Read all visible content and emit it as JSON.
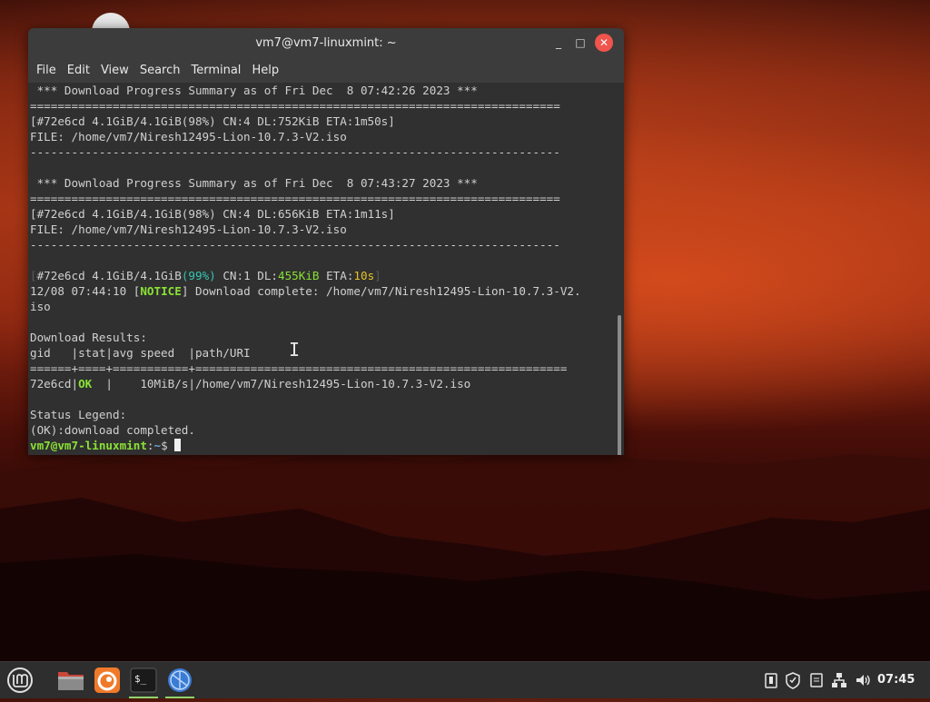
{
  "window": {
    "title": "vm7@vm7-linuxmint: ~",
    "minimize_glyph": "_",
    "maximize_glyph": "□",
    "close_glyph": "✕"
  },
  "menu": [
    "File",
    "Edit",
    "View",
    "Search",
    "Terminal",
    "Help"
  ],
  "terminal": {
    "lines": [
      [
        {
          "t": " *** Download Progress Summary as of Fri Dec  8 07:42:26 2023 ***"
        }
      ],
      [
        {
          "t": "============================================================================="
        }
      ],
      [
        {
          "t": "[#72e6cd 4.1GiB/4.1GiB(98%) CN:4 DL:752KiB ETA:1m50s]"
        }
      ],
      [
        {
          "t": "FILE: /home/vm7/Niresh12495-Lion-10.7.3-V2.iso"
        }
      ],
      [
        {
          "t": "-----------------------------------------------------------------------------"
        }
      ],
      [
        {
          "t": ""
        }
      ],
      [
        {
          "t": " *** Download Progress Summary as of Fri Dec  8 07:43:27 2023 ***"
        }
      ],
      [
        {
          "t": "============================================================================="
        }
      ],
      [
        {
          "t": "[#72e6cd 4.1GiB/4.1GiB(98%) CN:4 DL:656KiB ETA:1m11s]"
        }
      ],
      [
        {
          "t": "FILE: /home/vm7/Niresh12495-Lion-10.7.3-V2.iso"
        }
      ],
      [
        {
          "t": "-----------------------------------------------------------------------------"
        }
      ],
      [
        {
          "t": ""
        }
      ],
      [
        {
          "t": "[",
          "c": "dim"
        },
        {
          "t": "#72e6cd 4.1GiB/4.1GiB"
        },
        {
          "t": "(99%)",
          "c": "cyan"
        },
        {
          "t": " CN:1 DL:"
        },
        {
          "t": "455KiB",
          "c": "green"
        },
        {
          "t": " ETA:"
        },
        {
          "t": "10s",
          "c": "yellow"
        },
        {
          "t": "]",
          "c": "dim"
        }
      ],
      [
        {
          "t": "12/08 07:44:10 ["
        },
        {
          "t": "NOTICE",
          "c": "boldgreen"
        },
        {
          "t": "] Download complete: /home/vm7/Niresh12495-Lion-10.7.3-V2."
        }
      ],
      [
        {
          "t": "iso"
        }
      ],
      [
        {
          "t": ""
        }
      ],
      [
        {
          "t": "Download Results:"
        }
      ],
      [
        {
          "t": "gid   |stat|avg speed  |path/URI"
        }
      ],
      [
        {
          "t": "======+====+===========+======================================================"
        }
      ],
      [
        {
          "t": "72e6cd|"
        },
        {
          "t": "OK",
          "c": "boldgreen"
        },
        {
          "t": "  |    10MiB/s|/home/vm7/Niresh12495-Lion-10.7.3-V2.iso"
        }
      ],
      [
        {
          "t": ""
        }
      ],
      [
        {
          "t": "Status Legend:"
        }
      ],
      [
        {
          "t": "(OK):download completed."
        }
      ]
    ],
    "prompt_user": "vm7@vm7-linuxmint",
    "prompt_sep": ":",
    "prompt_path": "~",
    "prompt_symbol": "$ "
  },
  "taskbar": {
    "items": [
      {
        "name": "menu-button",
        "icon": "mint-logo-icon"
      },
      {
        "name": "taskbar-files",
        "icon": "folder-icon"
      },
      {
        "name": "taskbar-firefox",
        "icon": "firefox-icon"
      },
      {
        "name": "taskbar-terminal",
        "icon": "terminal-icon",
        "label": "$_"
      },
      {
        "name": "taskbar-web",
        "icon": "globe-icon"
      }
    ],
    "clock": "07:45"
  },
  "colors": {
    "green": "#8ae234",
    "cyan": "#34c6b4",
    "yellow": "#e6c228",
    "dim": "#5a5a5a",
    "close": "#f0544c"
  }
}
